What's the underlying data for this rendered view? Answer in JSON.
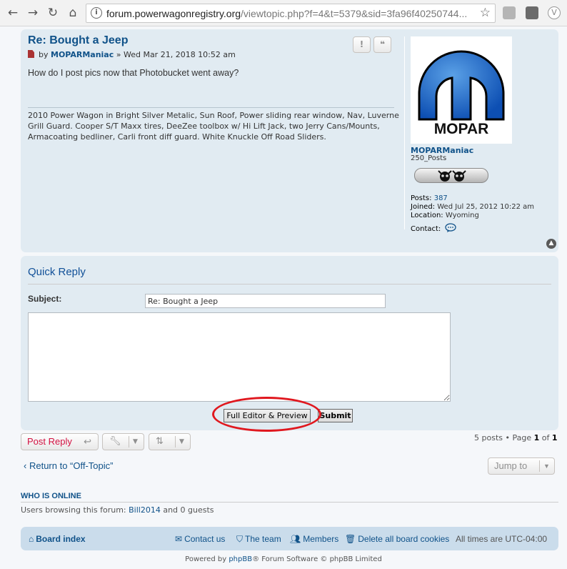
{
  "browser": {
    "url_host": "forum.powerwagonregistry.org",
    "url_rest": "/viewtopic.php?f=4&t=5379&sid=3fa96f40250744..."
  },
  "post": {
    "title": "Re: Bought a Jeep",
    "by": "by",
    "author": "MOPARManiac",
    "date": "» Wed Mar 21, 2018 10:52 am",
    "body": "How do I post pics now that Photobucket went away?",
    "signature": "2010 Power Wagon in Bright Silver Metalic, Sun Roof, Power sliding rear window, Nav, Luverne Grill Guard. Cooper S/T Maxx tires, DeeZee toolbox w/ Hi Lift Jack, two Jerry Cans/Mounts, Armacoating bedliner, Carli front diff guard. White Knuckle Off Road Sliders.",
    "report_btn": "!",
    "quote_btn": "❝"
  },
  "profile": {
    "logo_text": "MOPAR",
    "name": "MOPARManiac",
    "rank": "250_Posts",
    "posts_label": "Posts:",
    "posts_value": "387",
    "joined_label": "Joined:",
    "joined_value": "Wed Jul 25, 2012 10:22 am",
    "location_label": "Location:",
    "location_value": "Wyoming",
    "contact_label": "Contact:"
  },
  "quick_reply": {
    "title": "Quick Reply",
    "subject_label": "Subject:",
    "subject_value": "Re: Bought a Jeep",
    "full_editor_label": "Full Editor & Preview",
    "submit_label": "Submit"
  },
  "actions": {
    "post_reply_label": "Post Reply",
    "pagination_text": "5 posts • Page ",
    "page_current": "1",
    "page_of": " of ",
    "page_total": "1",
    "return_label": "Return to “Off-Topic”",
    "jump_to_label": "Jump to"
  },
  "who_online": {
    "title": "WHO IS ONLINE",
    "text_prefix": "Users browsing this forum: ",
    "user": "Bill2014",
    "text_suffix": " and 0 guests"
  },
  "footer": {
    "board_index": "Board index",
    "contact_us": "Contact us",
    "the_team": "The team",
    "members": "Members",
    "delete_cookies": "Delete all board cookies",
    "timezone": "All times are UTC-04:00",
    "powered_prefix": "Powered by ",
    "phpbb": "phpBB",
    "powered_suffix": "® Forum Software © phpBB Limited"
  },
  "colors": {
    "link": "#105289",
    "panel": "#e1ebf2",
    "footer_bar": "#cadceb",
    "annotation_circle": "#e0181f",
    "post_reply": "#d31141"
  }
}
